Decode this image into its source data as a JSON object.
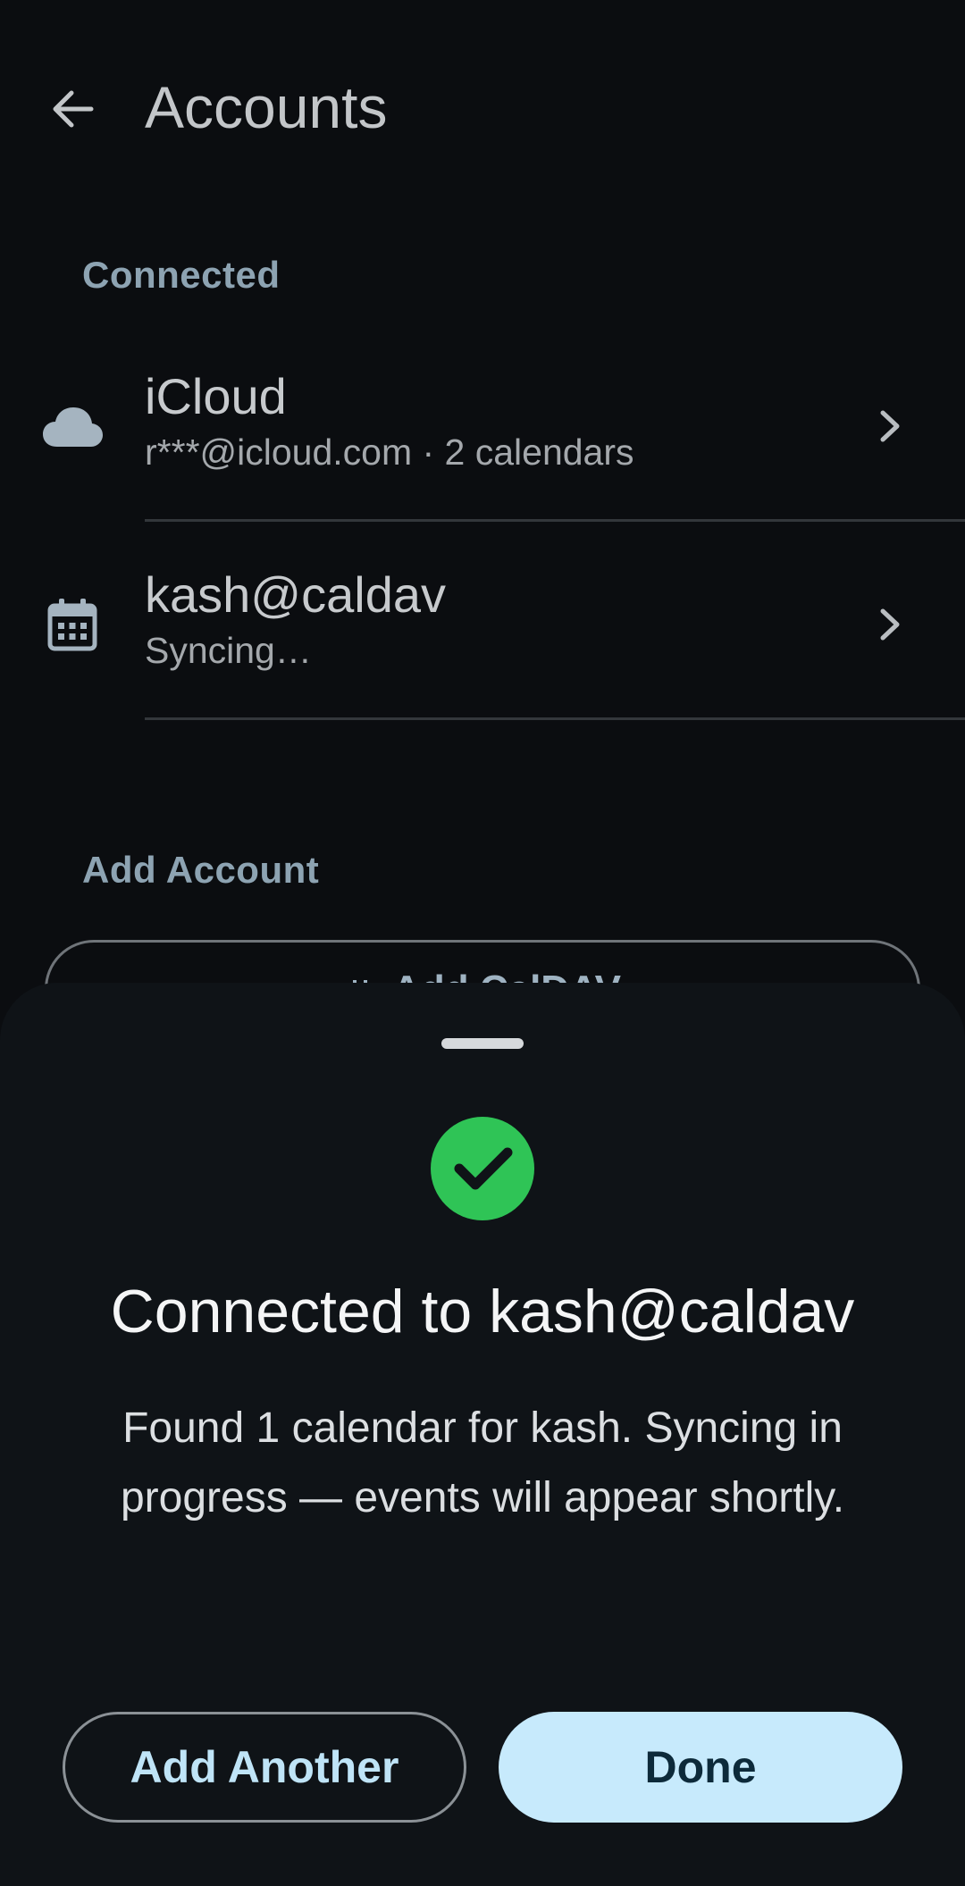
{
  "header": {
    "title": "Accounts",
    "back_icon": "arrow-back-icon"
  },
  "sections": {
    "connected_label": "Connected",
    "add_account_label": "Add Account"
  },
  "accounts": [
    {
      "title": "iCloud",
      "subtitle": "r***@icloud.com · 2 calendars",
      "icon": "cloud-icon"
    },
    {
      "title": "kash@caldav",
      "subtitle": "Syncing…",
      "icon": "calendar-icon"
    }
  ],
  "add_caldav": {
    "label": "Add CalDAV",
    "icon": "calendar-icon"
  },
  "sheet": {
    "title": "Connected to kash@caldav",
    "message": "Found 1 calendar for kash. Syncing in progress — events will appear shortly.",
    "add_another_label": "Add Another",
    "done_label": "Done",
    "success_color": "#2fc456"
  },
  "colors": {
    "background": "#0b0d10",
    "sheet_background": "#0f1317",
    "accent": "#c7eafc",
    "section_header": "#8da3b2"
  }
}
